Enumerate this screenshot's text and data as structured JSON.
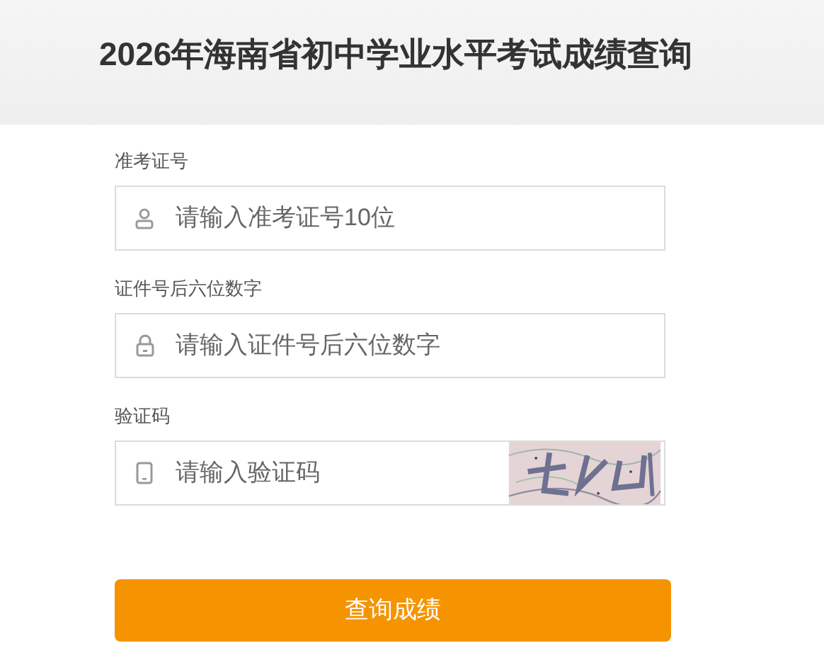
{
  "header": {
    "title": "2026年海南省初中学业水平考试成绩查询"
  },
  "fields": [
    {
      "label": "准考证号",
      "placeholder": "请输入准考证号10位",
      "kind": "person"
    },
    {
      "label": "证件号后六位数字",
      "placeholder": "请输入证件号后六位数字",
      "kind": "lock"
    },
    {
      "label": "验证码",
      "placeholder": "请输入验证码",
      "kind": "phone"
    }
  ],
  "submit": {
    "label": "查询成绩"
  }
}
